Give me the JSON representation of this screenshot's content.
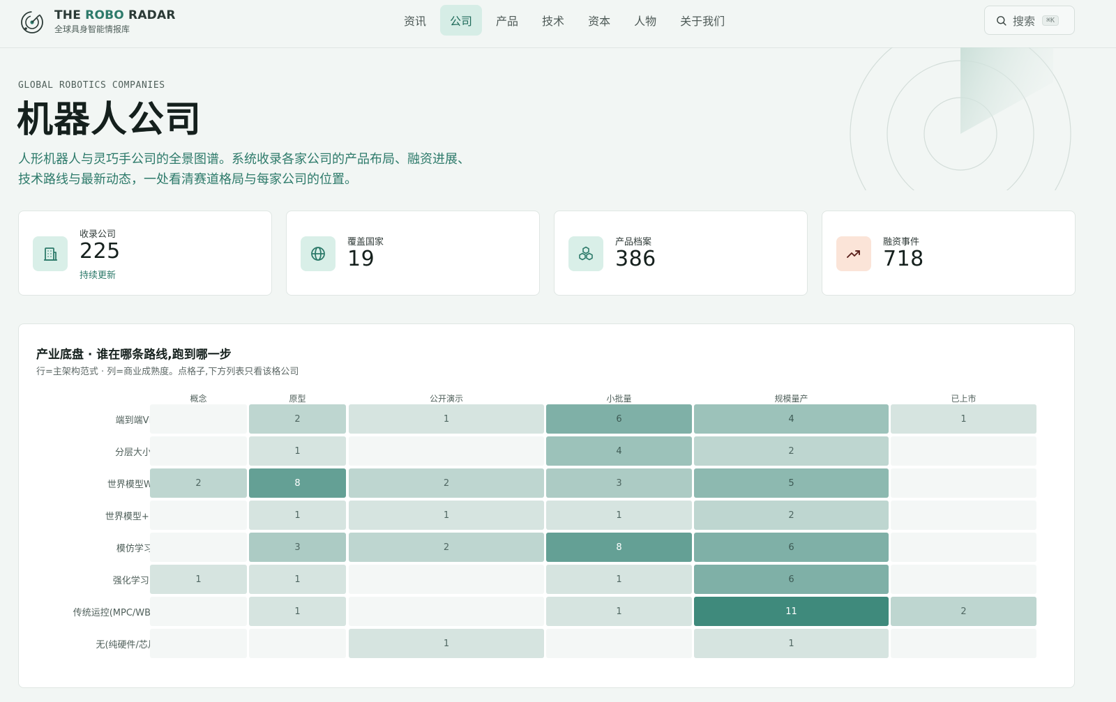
{
  "brand": {
    "title_part1": "THE ",
    "title_part2": "ROBO",
    "title_part3": " RADAR",
    "subtitle": "全球具身智能情报库"
  },
  "nav": {
    "items": [
      "资讯",
      "公司",
      "产品",
      "技术",
      "资本",
      "人物",
      "关于我们"
    ],
    "active_index": 1
  },
  "search": {
    "label": "搜索",
    "shortcut": "⌘K"
  },
  "hero": {
    "eyebrow": "GLOBAL ROBOTICS COMPANIES",
    "title": "机器人公司",
    "description_line1": "人形机器人与灵巧手公司的全景图谱。系统收录各家公司的产品布局、融资进展、",
    "description_line2": "技术路线与最新动态，一处看清赛道格局与每家公司的位置。"
  },
  "stats": [
    {
      "label": "收录公司",
      "value": "225",
      "note": "持续更新",
      "icon": "building-icon"
    },
    {
      "label": "覆盖国家",
      "value": "19",
      "icon": "globe-icon"
    },
    {
      "label": "产品档案",
      "value": "386",
      "icon": "cubes-icon"
    },
    {
      "label": "融资事件",
      "value": "718",
      "icon": "trending-up-icon"
    }
  ],
  "colors": {
    "accent": "#2d7a6a",
    "accent_light": "#d6ede6",
    "peach": "#fbe4d8",
    "heat_max": "#3f8a7c"
  },
  "matrix": {
    "title": "产业底盘 · 谁在哪条路线,跑到哪一步",
    "subtitle": "行=主架构范式 · 列=商业成熟度。点格子,下方列表只看该格公司",
    "columns": [
      "概念",
      "原型",
      "公开演示",
      "小批量",
      "规模量产",
      "已上市"
    ],
    "rows": [
      "端到端VLA",
      "分层大小脑",
      "世界模型WM",
      "世界模型+RL",
      "模仿学习IL",
      "强化学习RL",
      "传统运控(MPC/WBC)",
      "无(纯硬件/芯片)"
    ]
  },
  "chart_data": {
    "type": "heatmap",
    "title": "产业底盘 · 谁在哪条路线,跑到哪一步",
    "x": [
      "概念",
      "原型",
      "公开演示",
      "小批量",
      "规模量产",
      "已上市"
    ],
    "y": [
      "端到端VLA",
      "分层大小脑",
      "世界模型WM",
      "世界模型+RL",
      "模仿学习IL",
      "强化学习RL",
      "传统运控(MPC/WBC)",
      "无(纯硬件/芯片)"
    ],
    "values": [
      [
        null,
        2,
        1,
        6,
        4,
        1
      ],
      [
        null,
        1,
        null,
        4,
        2,
        null
      ],
      [
        2,
        8,
        2,
        3,
        5,
        null
      ],
      [
        null,
        1,
        1,
        1,
        2,
        null
      ],
      [
        null,
        3,
        2,
        8,
        6,
        null
      ],
      [
        1,
        1,
        null,
        1,
        6,
        null
      ],
      [
        null,
        1,
        null,
        1,
        11,
        2
      ],
      [
        null,
        null,
        1,
        null,
        1,
        null
      ]
    ],
    "max": 11
  }
}
